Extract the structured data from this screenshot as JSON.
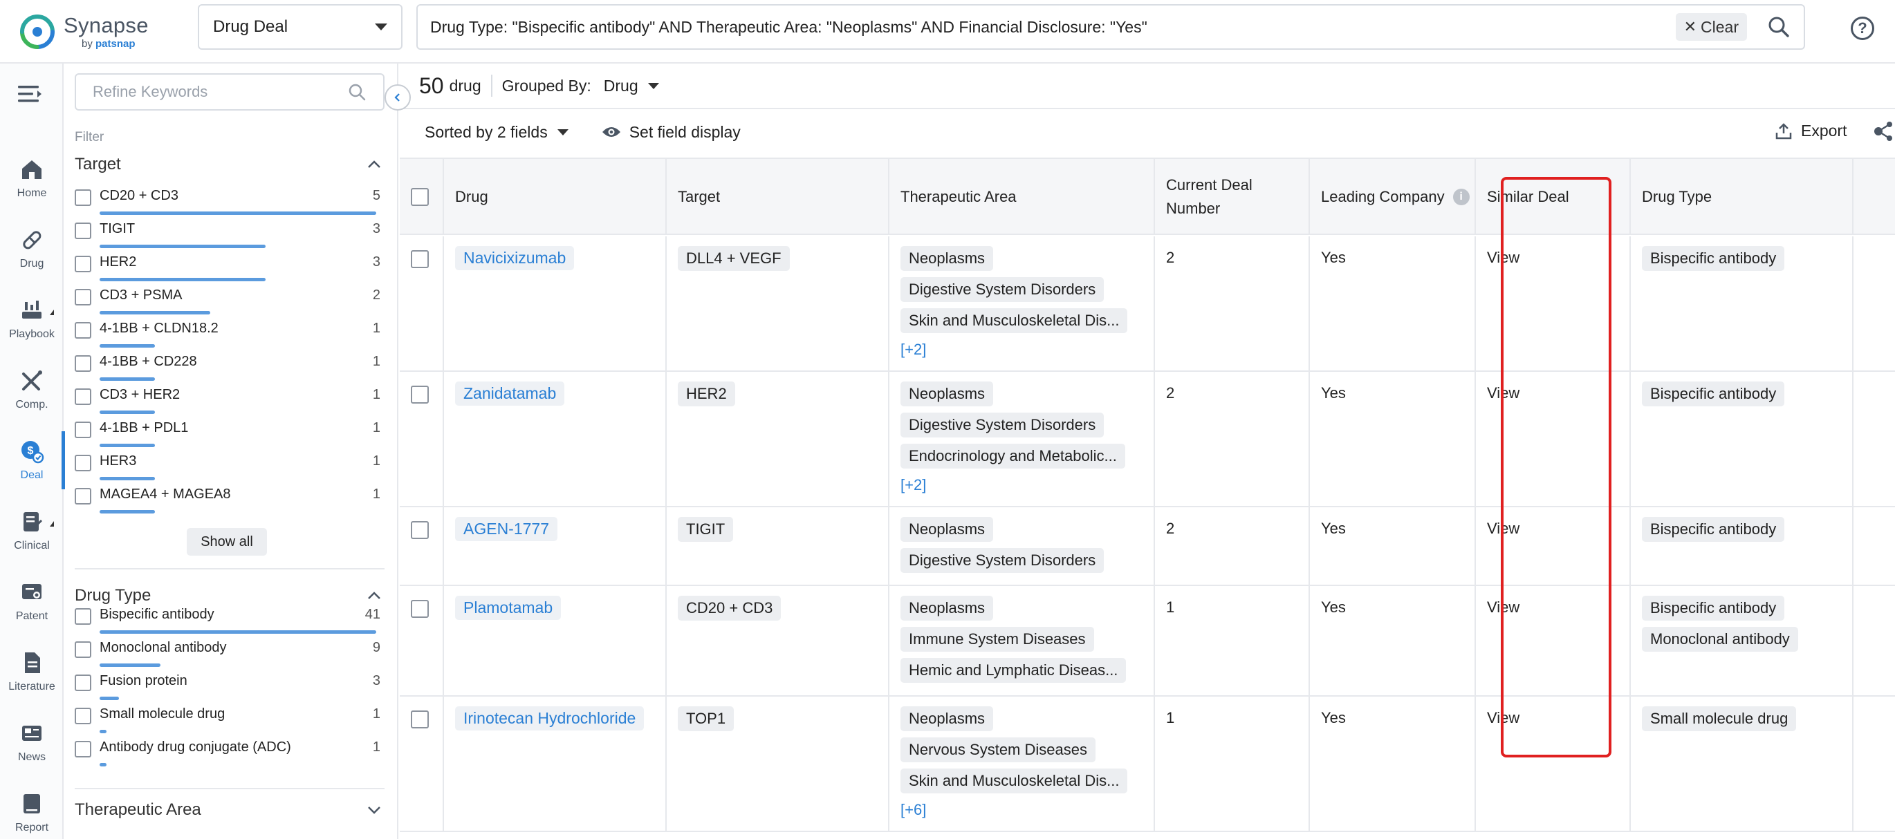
{
  "app": {
    "name": "Synapse",
    "by": "by",
    "brand": "patsnap",
    "brand_color": "#2a7fd4"
  },
  "topbar": {
    "module": "Drug Deal",
    "query": "Drug Type: \"Bispecific antibody\" AND Therapeutic Area: \"Neoplasms\" AND Financial Disclosure: \"Yes\"",
    "clear_label": "Clear"
  },
  "nav": [
    {
      "label": "Home",
      "icon": "home-icon"
    },
    {
      "label": "Drug",
      "icon": "pill-icon"
    },
    {
      "label": "Playbook",
      "icon": "playbook-icon"
    },
    {
      "label": "Comp.",
      "icon": "competition-icon"
    },
    {
      "label": "Deal",
      "icon": "deal-icon",
      "active": true
    },
    {
      "label": "Clinical",
      "icon": "clinical-icon"
    },
    {
      "label": "Patent",
      "icon": "patent-icon"
    },
    {
      "label": "Literature",
      "icon": "literature-icon"
    },
    {
      "label": "News",
      "icon": "news-icon"
    },
    {
      "label": "Report",
      "icon": "report-icon"
    }
  ],
  "filters": {
    "refine_placeholder": "Refine Keywords",
    "title": "Filter",
    "target": {
      "title": "Target",
      "items": [
        {
          "label": "CD20 + CD3",
          "count": "5",
          "fraction": 1.0
        },
        {
          "label": "TIGIT",
          "count": "3",
          "fraction": 0.6
        },
        {
          "label": "HER2",
          "count": "3",
          "fraction": 0.6
        },
        {
          "label": "CD3 + PSMA",
          "count": "2",
          "fraction": 0.4
        },
        {
          "label": "4-1BB + CLDN18.2",
          "count": "1",
          "fraction": 0.2
        },
        {
          "label": "4-1BB + CD228",
          "count": "1",
          "fraction": 0.2
        },
        {
          "label": "CD3 + HER2",
          "count": "1",
          "fraction": 0.2
        },
        {
          "label": "4-1BB + PDL1",
          "count": "1",
          "fraction": 0.2
        },
        {
          "label": "HER3",
          "count": "1",
          "fraction": 0.2
        },
        {
          "label": "MAGEA4 + MAGEA8",
          "count": "1",
          "fraction": 0.2
        }
      ],
      "show_all": "Show all"
    },
    "drug_type": {
      "title": "Drug Type",
      "items": [
        {
          "label": "Bispecific antibody",
          "count": "41",
          "fraction": 1.0
        },
        {
          "label": "Monoclonal antibody",
          "count": "9",
          "fraction": 0.22
        },
        {
          "label": "Fusion protein",
          "count": "3",
          "fraction": 0.07
        },
        {
          "label": "Small molecule drug",
          "count": "1",
          "fraction": 0.025
        },
        {
          "label": "Antibody drug conjugate (ADC)",
          "count": "1",
          "fraction": 0.025
        }
      ]
    },
    "therapeutic_area": {
      "title": "Therapeutic Area"
    }
  },
  "results": {
    "count": "50",
    "unit": "drug",
    "grouped_by_label": "Grouped By:",
    "grouped_by_value": "Drug",
    "sorted_label": "Sorted by 2 fields",
    "field_display_label": "Set field display",
    "export_label": "Export"
  },
  "table": {
    "columns": [
      "Drug",
      "Target",
      "Therapeutic Area",
      "Current Deal Number",
      "Leading Company",
      "Similar Deal",
      "Drug Type"
    ],
    "rows": [
      {
        "drug": "Navicixizumab",
        "target": "DLL4 + VEGF",
        "areas": [
          "Neoplasms",
          "Digestive System Disorders",
          "Skin and Musculoskeletal Dis..."
        ],
        "more": "[+2]",
        "deal_number": "2",
        "leading": "Yes",
        "similar": "View",
        "types": [
          "Bispecific antibody"
        ]
      },
      {
        "drug": "Zanidatamab",
        "target": "HER2",
        "areas": [
          "Neoplasms",
          "Digestive System Disorders",
          "Endocrinology and Metabolic..."
        ],
        "more": "[+2]",
        "deal_number": "2",
        "leading": "Yes",
        "similar": "View",
        "types": [
          "Bispecific antibody"
        ]
      },
      {
        "drug": "AGEN-1777",
        "target": "TIGIT",
        "areas": [
          "Neoplasms",
          "Digestive System Disorders"
        ],
        "more": "",
        "deal_number": "2",
        "leading": "Yes",
        "similar": "View",
        "types": [
          "Bispecific antibody"
        ]
      },
      {
        "drug": "Plamotamab",
        "target": "CD20 + CD3",
        "areas": [
          "Neoplasms",
          "Immune System Diseases",
          "Hemic and Lymphatic Diseas..."
        ],
        "more": "",
        "deal_number": "1",
        "leading": "Yes",
        "similar": "View",
        "types": [
          "Bispecific antibody",
          "Monoclonal antibody"
        ]
      },
      {
        "drug": "Irinotecan Hydrochloride",
        "target": "TOP1",
        "areas": [
          "Neoplasms",
          "Nervous System Diseases",
          "Skin and Musculoskeletal Dis..."
        ],
        "more": "[+6]",
        "deal_number": "1",
        "leading": "Yes",
        "similar": "View",
        "types": [
          "Small molecule drug"
        ]
      }
    ]
  }
}
